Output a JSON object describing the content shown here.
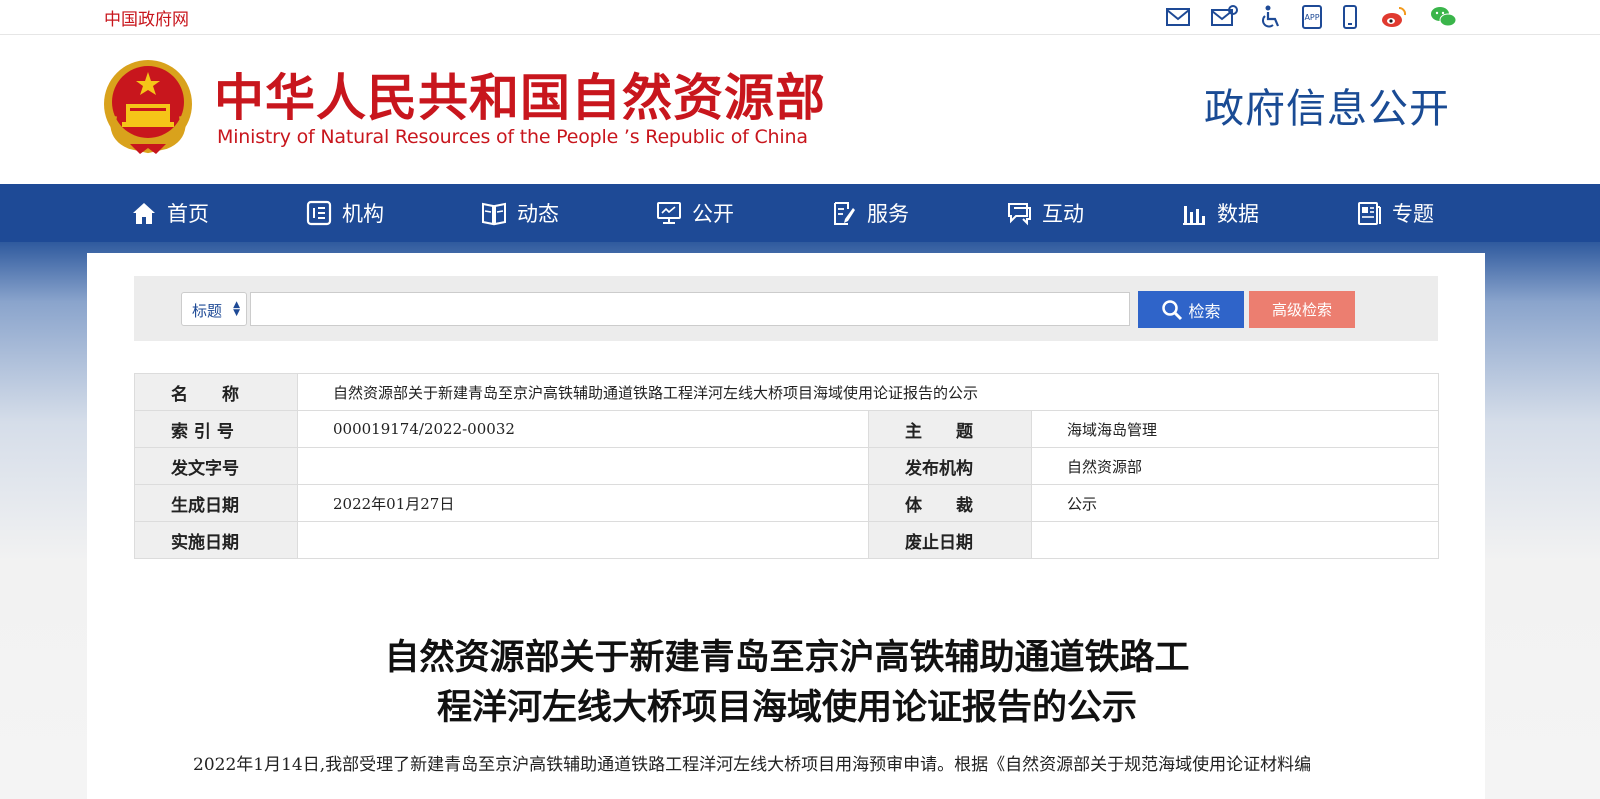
{
  "topbar": {
    "gov_link": "中国政府网",
    "icons": [
      "mail-icon",
      "mail-settings-icon",
      "accessibility-icon",
      "app-icon",
      "mobile-icon",
      "weibo-icon",
      "wechat-icon"
    ]
  },
  "header": {
    "title_cn": "中华人民共和国自然资源部",
    "title_en": "Ministry of Natural Resources of the People ’s Republic of China",
    "right_title": "政府信息公开"
  },
  "nav": {
    "items": [
      {
        "label": "首页",
        "icon": "home-icon"
      },
      {
        "label": "机构",
        "icon": "organization-icon"
      },
      {
        "label": "动态",
        "icon": "news-icon"
      },
      {
        "label": "公开",
        "icon": "monitor-icon"
      },
      {
        "label": "服务",
        "icon": "service-icon"
      },
      {
        "label": "互动",
        "icon": "chat-icon"
      },
      {
        "label": "数据",
        "icon": "chart-icon"
      },
      {
        "label": "专题",
        "icon": "topic-icon"
      }
    ]
  },
  "search": {
    "select_value": "标题",
    "input_value": "",
    "search_label": "检索",
    "advanced_label": "高级检索"
  },
  "meta": {
    "name_label": "名　　称",
    "name_value": "自然资源部关于新建青岛至京沪高铁辅助通道铁路工程洋河左线大桥项目海域使用论证报告的公示",
    "index_label": "索 引 号",
    "index_value": "000019174/2022-00032",
    "topic_label": "主　　题",
    "topic_value": "海域海岛管理",
    "doc_no_label": "发文字号",
    "doc_no_value": "",
    "publisher_label": "发布机构",
    "publisher_value": "自然资源部",
    "created_label": "生成日期",
    "created_value": "2022年01月27日",
    "genre_label": "体　　裁",
    "genre_value": "公示",
    "effective_label": "实施日期",
    "effective_value": "",
    "expire_label": "废止日期",
    "expire_value": ""
  },
  "article": {
    "title_line1": "自然资源部关于新建青岛至京沪高铁辅助通道铁路工",
    "title_line2": "程洋河左线大桥项目海域使用论证报告的公示",
    "body": "2022年1月14日,我部受理了新建青岛至京沪高铁辅助通道铁路工程洋河左线大桥项目用海预审申请。根据《自然资源部关于规范海域使用论证材料编"
  },
  "colors": {
    "brand_red": "#c8161d",
    "nav_blue": "#1e4a96",
    "search_blue": "#2f64c9",
    "advanced_red": "#ec7e70"
  }
}
